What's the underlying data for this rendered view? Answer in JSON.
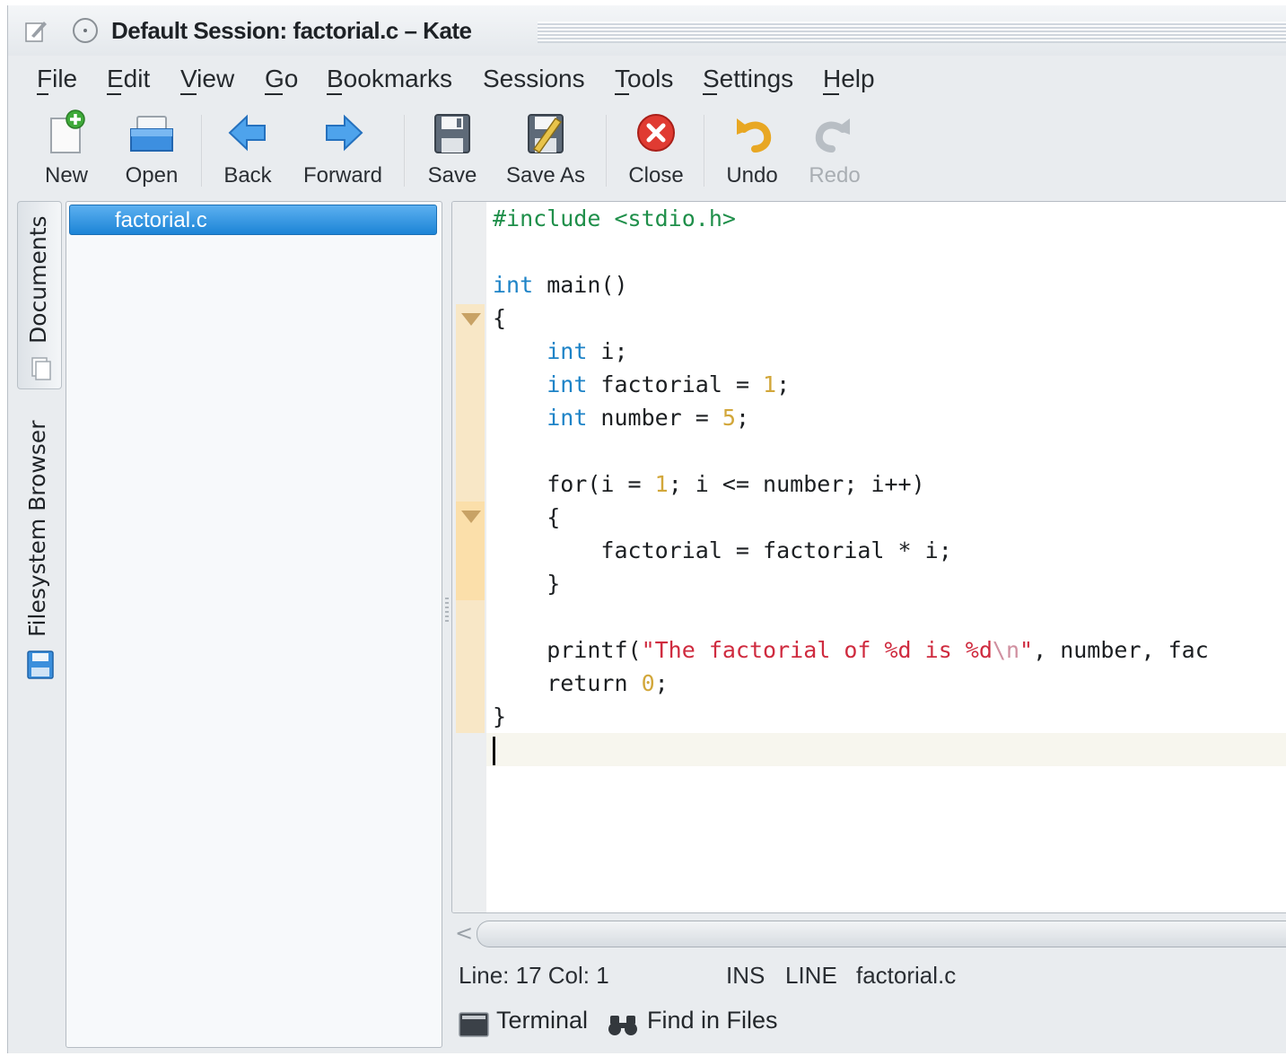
{
  "window": {
    "title": "Default Session: factorial.c – Kate"
  },
  "menu": [
    {
      "label": "File",
      "mnemonic": "F"
    },
    {
      "label": "Edit",
      "mnemonic": "E"
    },
    {
      "label": "View",
      "mnemonic": "V"
    },
    {
      "label": "Go",
      "mnemonic": "G"
    },
    {
      "label": "Bookmarks",
      "mnemonic": "B"
    },
    {
      "label": "Sessions",
      "mnemonic": "S"
    },
    {
      "label": "Tools",
      "mnemonic": "T"
    },
    {
      "label": "Settings",
      "mnemonic": "S"
    },
    {
      "label": "Help",
      "mnemonic": "H"
    }
  ],
  "toolbar": [
    {
      "label": "New",
      "icon": "new-document-icon",
      "enabled": true
    },
    {
      "label": "Open",
      "icon": "open-folder-icon",
      "enabled": true
    },
    {
      "label": "Back",
      "icon": "back-arrow-icon",
      "enabled": true
    },
    {
      "label": "Forward",
      "icon": "forward-arrow-icon",
      "enabled": true
    },
    {
      "label": "Save",
      "icon": "save-icon",
      "enabled": true
    },
    {
      "label": "Save As",
      "icon": "save-as-icon",
      "enabled": true
    },
    {
      "label": "Close",
      "icon": "close-icon",
      "enabled": true
    },
    {
      "label": "Undo",
      "icon": "undo-icon",
      "enabled": true
    },
    {
      "label": "Redo",
      "icon": "redo-icon",
      "enabled": false
    }
  ],
  "sidebar": {
    "tabs": [
      {
        "label": "Documents",
        "icon": "documents-icon",
        "active": true
      },
      {
        "label": "Filesystem Browser",
        "icon": "filesystem-icon",
        "active": false
      }
    ]
  },
  "documents": [
    {
      "name": "factorial.c",
      "selected": true
    }
  ],
  "editor": {
    "language": "C",
    "code_lines": [
      "#include <stdio.h>",
      "",
      "int main()",
      "{",
      "    int i;",
      "    int factorial = 1;",
      "    int number = 5;",
      "",
      "    for(i = 1; i <= number; i++)",
      "    {",
      "        factorial = factorial * i;",
      "    }",
      "",
      "    printf(\"The factorial of %d is %d\\n\", number, fac",
      "    return 0;",
      "}",
      ""
    ],
    "current_line": 17
  },
  "statusbar": {
    "position": "Line: 17 Col: 1",
    "mode": "INS",
    "selection_mode": "LINE",
    "filename": "factorial.c"
  },
  "bottom_views": [
    {
      "label": "Terminal",
      "icon": "terminal-icon"
    },
    {
      "label": "Find in Files",
      "icon": "binoculars-icon"
    }
  ],
  "colors": {
    "keyword": "#1d83c7",
    "number": "#d2a73a",
    "string": "#cf2b3f",
    "preprocessor": "#1f8f4a",
    "selection": "#1c84d6"
  }
}
